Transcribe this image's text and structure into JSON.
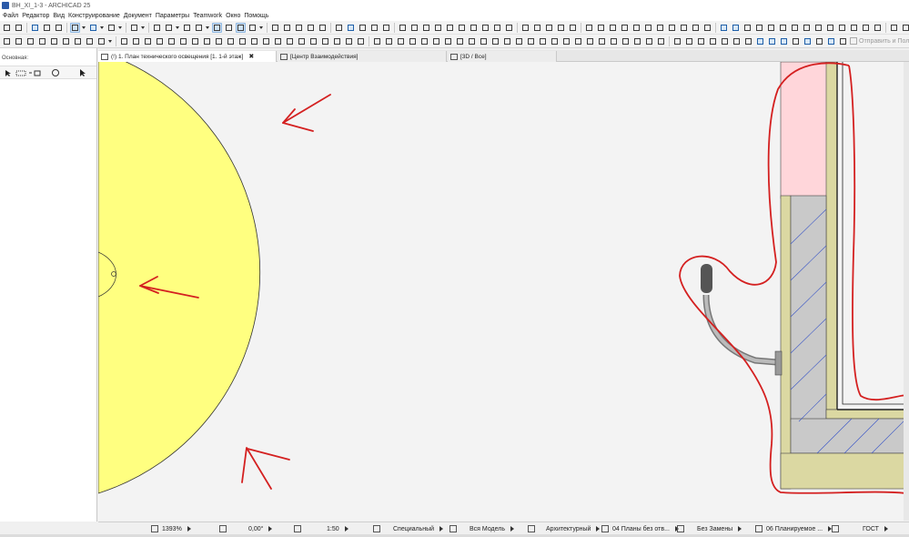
{
  "window": {
    "title": "BH_XI_1-3 - ARCHICAD 25"
  },
  "menu": [
    "Файл",
    "Редактор",
    "Вид",
    "Конструирование",
    "Документ",
    "Параметры",
    "Teamwork",
    "Окно",
    "Помощь"
  ],
  "toolbar": {
    "send_receive_label": "Отправить и Получить"
  },
  "toolbox": {
    "header": "Основная:"
  },
  "tabs": [
    {
      "label": "(!) 1. План технического освещения [1. 1-й этаж]",
      "close": "✖"
    },
    {
      "label": "[Центр Взаимодействия]"
    },
    {
      "label": "[3D / Все]"
    }
  ],
  "status_bar": {
    "zoom": "1393%",
    "angle": "0,00°",
    "scale": "1:50",
    "layer_combo": "Специальный",
    "model_view": "Вся Модель",
    "pen_set": "Архитектурный",
    "mvo": "04 Планы без отв...",
    "override": "Без Замены",
    "renovation": "06 Планируемое ...",
    "standard": "ГОСТ"
  },
  "icons": [
    "app-icon",
    "undo-icon",
    "redo-icon",
    "arrow-tool-icon",
    "marquee-tool-icon",
    "wall-tool-icon",
    "door-tool-icon",
    "window-tool-icon",
    "column-tool-icon",
    "slab-tool-icon",
    "stair-tool-icon",
    "grid-icon",
    "layers-icon",
    "lamp-icon"
  ],
  "colors": {
    "light_cone": "#ffff80",
    "annotation_red": "#d42020",
    "wall_fill": "#c9c9c9",
    "insulation": "#dbd8a2",
    "pink_zone": "#ffd6da",
    "selection_blue": "#cfe3f7"
  }
}
